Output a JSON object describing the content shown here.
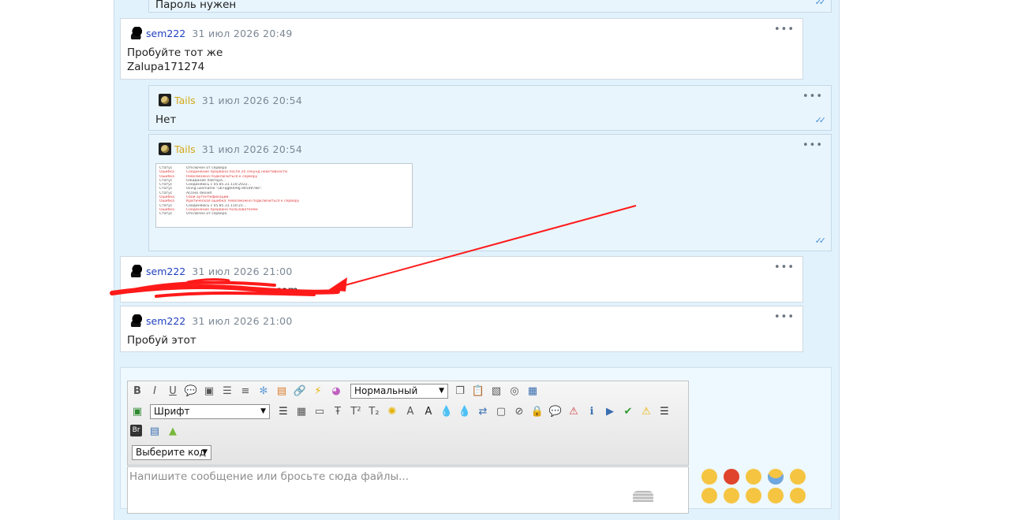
{
  "top_partial": {
    "text": "Пароль нужен"
  },
  "messages": [
    {
      "author": "sem222",
      "date": "31 июл 2026 20:49",
      "lines": [
        "Пробуйте тот же",
        "Zalupa171274"
      ]
    },
    {
      "author": "Tails",
      "date": "31 июл 2026 20:54",
      "text": "Нет"
    },
    {
      "author": "Tails",
      "date": "31 июл 2026 20:54",
      "log": [
        [
          "Статус",
          "Отключен от сервера",
          "ok"
        ],
        [
          "Ошибка",
          "Соединение прервано после 20 секунд неактивности",
          "err"
        ],
        [
          "Ошибка",
          "Невозможно подключиться к серверу",
          "err"
        ],
        [
          "Статус",
          "Ожидание повтора...",
          "ok"
        ],
        [
          "Статус",
          "Соединяюсь с 45.85.31.110:2022...",
          "ok"
        ],
        [
          "Статус",
          "Using username \"ub7qgb009g.945d978e\".",
          "ok"
        ],
        [
          "Статус",
          "Access denied",
          "ok"
        ],
        [
          "Ошибка",
          "Сбой аутентификации.",
          "err"
        ],
        [
          "Ошибка",
          "Критическая ошибка: Невозможно подключиться к серверу",
          "err"
        ],
        [
          "Статус",
          "Соединяюсь с 45.85.31.110:21...",
          "ok"
        ],
        [
          "Ошибка",
          "Соединение прервано пользователем",
          "err"
        ],
        [
          "Статус",
          "Отключен от сервера",
          "ok"
        ]
      ]
    },
    {
      "author": "sem222",
      "date": "31 июл 2026 21:00",
      "text": "com"
    },
    {
      "author": "sem222",
      "date": "31 июл 2026 21:00",
      "text": "Пробуй этот"
    }
  ],
  "menu_dots": "•••",
  "read_ticks": "✓✓",
  "editor": {
    "toolbar_row1": [
      "B",
      "I",
      "U"
    ],
    "format_select": "Нормальный",
    "font_select": "Шрифт",
    "code_select": "Выберите код",
    "br_label": "Br",
    "placeholder": "Напишите сообщение или бросьте сюда файлы..."
  },
  "colors": {
    "panel": "#e1f2fc",
    "arrow": "#ff1a1a",
    "link": "#1f3fbf",
    "gold": "#d6a818"
  }
}
